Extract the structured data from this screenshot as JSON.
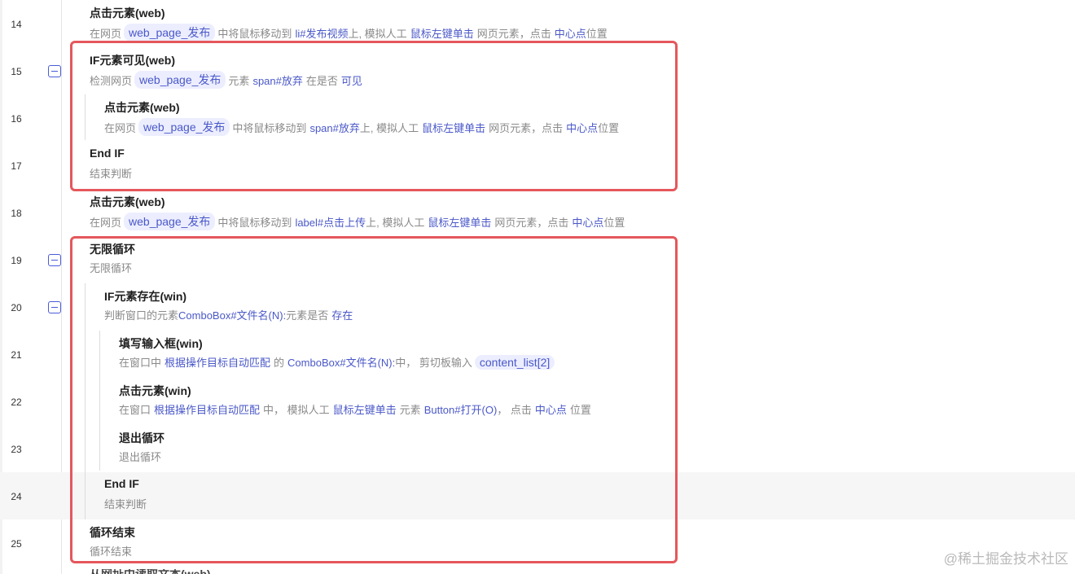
{
  "rows": [
    {
      "num": "14",
      "title": "点击元素(web)",
      "desc": [
        {
          "t": "在网页"
        },
        {
          "chip": "web_page_发布"
        },
        {
          "t": "中将鼠标移动到"
        },
        {
          "sp": 1
        },
        {
          "kw": "li#发布视频"
        },
        {
          "t": "上, 模拟人工"
        },
        {
          "sp": 1
        },
        {
          "kw": "鼠标左键单击"
        },
        {
          "sp": 1
        },
        {
          "t": "网页元素，点击"
        },
        {
          "sp": 1
        },
        {
          "kw": "中心点"
        },
        {
          "t": "位置"
        }
      ]
    },
    {
      "num": "15",
      "title": "IF元素可见(web)",
      "desc": [
        {
          "t": "检测网页"
        },
        {
          "chip": "web_page_发布"
        },
        {
          "t": "元素"
        },
        {
          "sp": 1
        },
        {
          "kw": "span#放弃"
        },
        {
          "sp": 1
        },
        {
          "t": "在是否"
        },
        {
          "sp": 1
        },
        {
          "kw": "可见"
        }
      ]
    },
    {
      "num": "16",
      "title": "点击元素(web)",
      "desc": [
        {
          "t": "在网页"
        },
        {
          "chip": "web_page_发布"
        },
        {
          "t": "中将鼠标移动到"
        },
        {
          "sp": 1
        },
        {
          "kw": "span#放弃"
        },
        {
          "t": "上, 模拟人工"
        },
        {
          "sp": 1
        },
        {
          "kw": "鼠标左键单击"
        },
        {
          "sp": 1
        },
        {
          "t": "网页元素，点击"
        },
        {
          "sp": 1
        },
        {
          "kw": "中心点"
        },
        {
          "t": "位置"
        }
      ]
    },
    {
      "num": "17",
      "title": "End IF",
      "desc": [
        {
          "t": "结束判断"
        }
      ]
    },
    {
      "num": "18",
      "title": "点击元素(web)",
      "desc": [
        {
          "t": "在网页"
        },
        {
          "chip": "web_page_发布"
        },
        {
          "t": "中将鼠标移动到"
        },
        {
          "sp": 1
        },
        {
          "kw": "label#点击上传"
        },
        {
          "t": "上, 模拟人工"
        },
        {
          "sp": 1
        },
        {
          "kw": "鼠标左键单击"
        },
        {
          "sp": 1
        },
        {
          "t": "网页元素，点击"
        },
        {
          "sp": 1
        },
        {
          "kw": "中心点"
        },
        {
          "t": "位置"
        }
      ]
    },
    {
      "num": "19",
      "title": "无限循环",
      "desc": [
        {
          "t": "无限循环"
        }
      ]
    },
    {
      "num": "20",
      "title": "IF元素存在(win)",
      "desc": [
        {
          "t": "判断窗口的元素"
        },
        {
          "kw": "ComboBox#文件名(N):"
        },
        {
          "t": "元素是否"
        },
        {
          "sp": 1
        },
        {
          "kw": "存在"
        }
      ]
    },
    {
      "num": "21",
      "title": "填写输入框(win)",
      "desc": [
        {
          "t": "在窗口中"
        },
        {
          "sp": 1
        },
        {
          "kw": "根据操作目标自动匹配"
        },
        {
          "sp": 1
        },
        {
          "t": "的"
        },
        {
          "sp": 1
        },
        {
          "kw": "ComboBox#文件名(N):"
        },
        {
          "t": "中，  剪切板输入"
        },
        {
          "chip": "content_list[2]"
        }
      ]
    },
    {
      "num": "22",
      "title": "点击元素(win)",
      "desc": [
        {
          "t": "在窗口"
        },
        {
          "sp": 1
        },
        {
          "kw": "根据操作目标自动匹配"
        },
        {
          "sp": 1
        },
        {
          "t": "中，  模拟人工"
        },
        {
          "sp": 1
        },
        {
          "kw": "鼠标左键单击"
        },
        {
          "sp": 1
        },
        {
          "t": "元素"
        },
        {
          "sp": 1
        },
        {
          "kw": "Button#打开(O)"
        },
        {
          "t": "，  点击"
        },
        {
          "sp": 1
        },
        {
          "kw": "中心点"
        },
        {
          "sp": 1
        },
        {
          "t": "位置"
        }
      ]
    },
    {
      "num": "23",
      "title": "退出循环",
      "desc": [
        {
          "t": "退出循环"
        }
      ]
    },
    {
      "num": "24",
      "title": "End IF",
      "desc": [
        {
          "t": "结束判断"
        }
      ]
    },
    {
      "num": "25",
      "title": "循环结束",
      "desc": [
        {
          "t": "循环结束"
        }
      ]
    }
  ],
  "partial_next_title": "从网址中读取文本(web)",
  "watermark": "@稀土掘金技术社区",
  "colors": {
    "accent": "#4a58c8",
    "highlight_box": "#e5575c"
  }
}
